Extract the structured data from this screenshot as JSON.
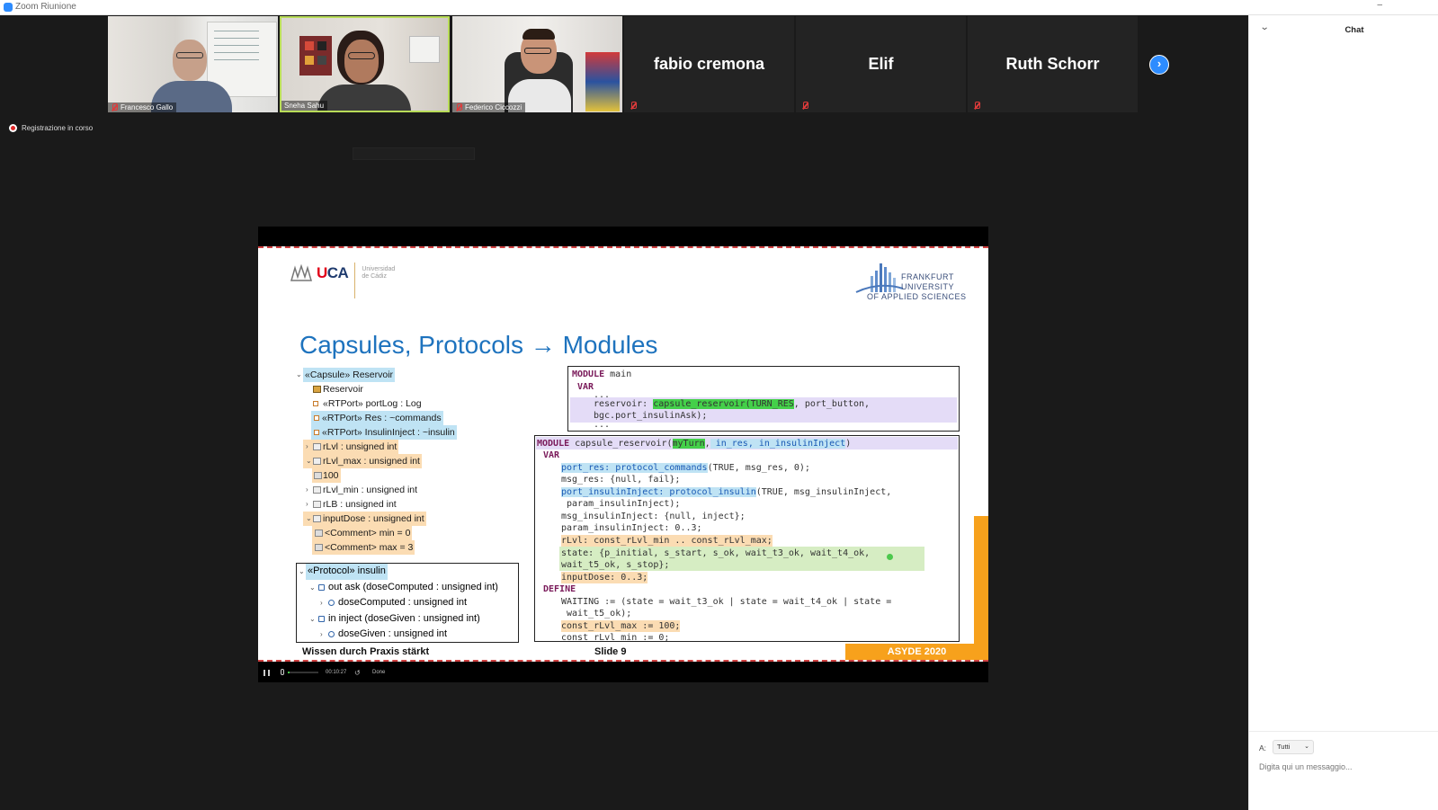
{
  "window": {
    "title": "Zoom Riunione"
  },
  "participants": [
    {
      "name": "Francesco Gallo",
      "muted": true
    },
    {
      "name": "Sneha Sahu",
      "muted": false,
      "speaking": true
    },
    {
      "name": "Federico Ciccozzi",
      "muted": true
    },
    {
      "name": "fabio cremona",
      "muted": true
    },
    {
      "name": "Elif",
      "muted": true
    },
    {
      "name": "Ruth Schorr",
      "muted": true
    }
  ],
  "recording": {
    "label": "Registrazione in corso"
  },
  "slide": {
    "uca": {
      "wordmark_u": "U",
      "wordmark_rest": "CA",
      "sub1": "Universidad",
      "sub2": "de Cádiz"
    },
    "frankfurt": {
      "line1": "FRANKFURT",
      "line2": "UNIVERSITY",
      "line3": "OF APPLIED SCIENCES"
    },
    "title": "Capsules, Protocols → Modules",
    "tree": [
      "«Capsule» Reservoir",
      "Reservoir",
      "«RTPort» portLog : Log",
      "«RTPort» Res : ~commands",
      "«RTPort» InsulinInject : ~insulin",
      "rLvl : unsigned int",
      "rLvl_max : unsigned int",
      "100",
      "rLvl_min : unsigned int",
      "rLB : unsigned int",
      "inputDose : unsigned int",
      "<Comment> min = 0",
      "<Comment> max = 3"
    ],
    "protocol": [
      "«Protocol» insulin",
      "out ask (doseComputed : unsigned int)",
      "doseComputed : unsigned int",
      "in inject (doseGiven : unsigned int)",
      "doseGiven : unsigned int"
    ],
    "code_main": {
      "kw_module": "MODULE",
      "name": " main",
      "kw_var": "VAR",
      "dots1": "...",
      "line_a_pre": "reservoir: ",
      "line_a_call": "capsule_reservoir",
      "line_a_arg": "(TURN_RES",
      "line_a_rest": ", port_button,",
      "line_b": "bgc.port_insulinAsk);",
      "dots2": "..."
    },
    "code_capsule": {
      "kw_module": "MODULE",
      "name": " capsule_reservoir(",
      "param_turn": "myTurn",
      "param_sep": ",",
      "params_rest": " in_res, in_insulinInject",
      "close": ")",
      "kw_var": "VAR",
      "l1_a": "port_res: protocol_commands",
      "l1_b": "(TRUE, msg_res, 0);",
      "l2": "msg_res: {null, fail};",
      "l3_a": "port_insulinInject: protocol_insulin",
      "l3_b": "(TRUE, msg_insulinInject,",
      "l4": " param_insulinInject);",
      "l5": "msg_insulinInject: {null, inject};",
      "l6": "param_insulinInject: 0..3;",
      "l7": "rLvl: const_rLvl_min .. const_rLvl_max;",
      "l8": "state: {p_initial, s_start, s_ok, wait_t3_ok, wait_t4_ok,",
      "l9": "wait_t5_ok, s_stop};",
      "l10": "inputDose: 0..3;",
      "kw_define": "DEFINE",
      "l11": "WAITING := (state = wait_t3_ok | state = wait_t4_ok | state =",
      "l12": " wait_t5_ok);",
      "l13": "const_rLvl_max := 100;",
      "l14": "const_rLvl_min := 0;"
    },
    "footer": {
      "left": "Wissen durch Praxis stärkt",
      "mid": "Slide  9",
      "right": "ASYDE 2020"
    }
  },
  "player": {
    "time": "00:10:27",
    "done": "Done"
  },
  "chat": {
    "title": "Chat",
    "to_label": "A:",
    "to_value": "Tutti",
    "placeholder": "Digita qui un messaggio..."
  },
  "colors": {
    "accent": "#2d8cff",
    "speaker_border": "#b8dc58",
    "slide_title": "#1e73be",
    "asyde_orange": "#f7a11c"
  }
}
